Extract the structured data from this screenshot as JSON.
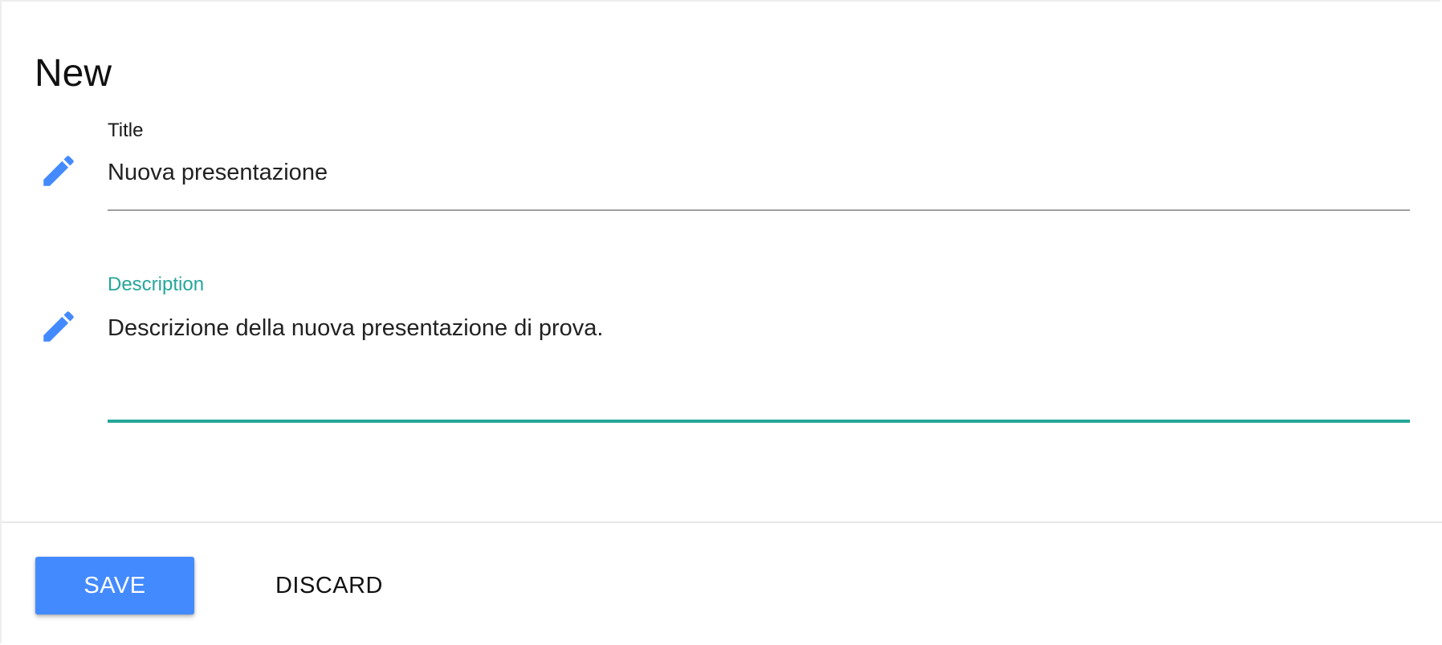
{
  "form": {
    "heading": "New",
    "fields": [
      {
        "label": "Title",
        "value": "Nuova presentazione",
        "icon": "pencil-icon",
        "active": false
      },
      {
        "label": "Description",
        "value": "Descrizione della nuova presentazione di prova.",
        "icon": "pencil-icon",
        "active": true
      }
    ]
  },
  "actions": {
    "save_label": "SAVE",
    "discard_label": "DISCARD"
  },
  "colors": {
    "accent": "#448aff",
    "active_field": "#26a69a",
    "icon": "#448aff",
    "inactive_line": "#9e9e9e"
  }
}
